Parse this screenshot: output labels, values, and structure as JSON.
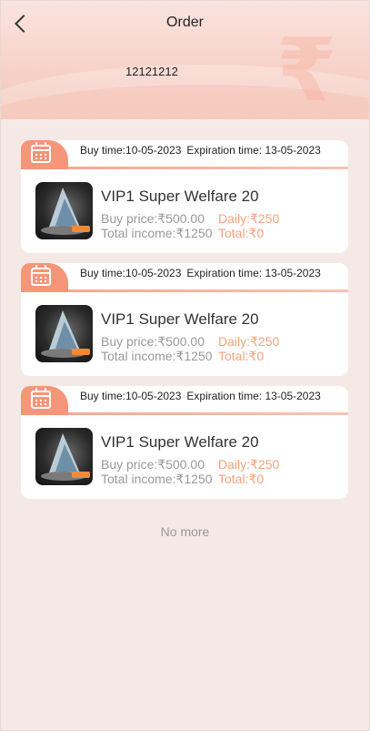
{
  "header": {
    "title": "Order",
    "user_id": "12121212"
  },
  "orders": [
    {
      "buy_time": "Buy time:10-05-2023",
      "expiration_time": "Expiration time: 13-05-2023",
      "name": "VIP1 Super Welfare 20",
      "buy_price": "Buy price:₹500.00",
      "daily": "Daily:₹250",
      "total_income": "Total income:₹1250",
      "total": "Total:₹0"
    },
    {
      "buy_time": "Buy time:10-05-2023",
      "expiration_time": "Expiration time: 13-05-2023",
      "name": "VIP1 Super Welfare 20",
      "buy_price": "Buy price:₹500.00",
      "daily": "Daily:₹250",
      "total_income": "Total income:₹1250",
      "total": "Total:₹0"
    },
    {
      "buy_time": "Buy time:10-05-2023",
      "expiration_time": "Expiration time: 13-05-2023",
      "name": "VIP1 Super Welfare 20",
      "buy_price": "Buy price:₹500.00",
      "daily": "Daily:₹250",
      "total_income": "Total income:₹1250",
      "total": "Total:₹0"
    }
  ],
  "footer": {
    "no_more": "No more"
  },
  "icons": [
    "back-arrow-icon",
    "rupee-icon",
    "calendar-icon"
  ],
  "colors": {
    "accent": "#f6957a",
    "highlight": "#f5a27e",
    "background": "#f5e9e6"
  }
}
